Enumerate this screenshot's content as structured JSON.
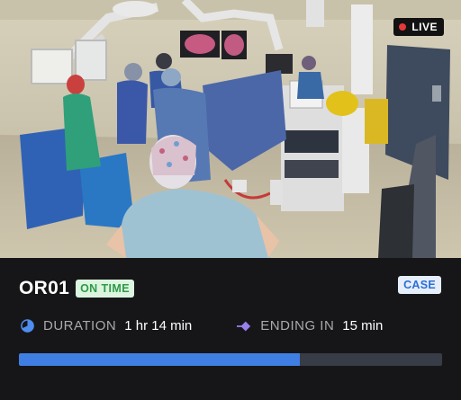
{
  "camera": {
    "live_label": "LIVE",
    "live_color": "#e2393a"
  },
  "room": {
    "name": "OR01",
    "status": "ON TIME",
    "status_color": "#2f9a47",
    "case_button": "CASE"
  },
  "duration": {
    "icon": "pie-clock-icon",
    "label": "DURATION",
    "value": "1 hr 14 min"
  },
  "ending": {
    "icon": "diamond-arrow-icon",
    "label": "ENDING IN",
    "value": "15 min"
  },
  "progress": {
    "fraction": 0.664,
    "fill_color": "#3f7fe3"
  }
}
